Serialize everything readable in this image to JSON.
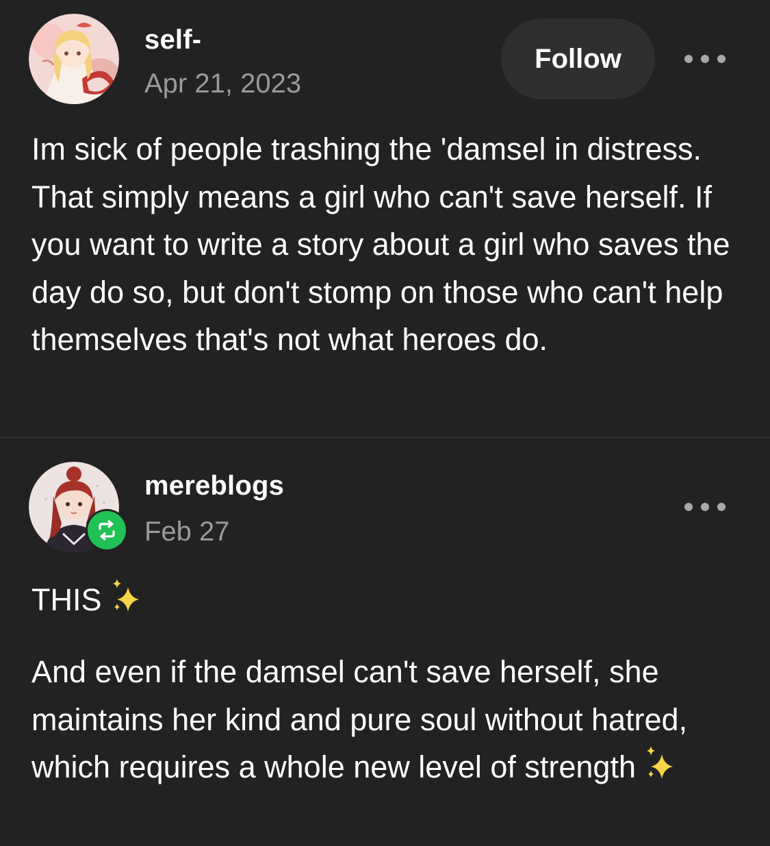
{
  "colors": {
    "background": "#222222",
    "text": "#ffffff",
    "muted": "#9a9a9a",
    "button_bg": "#2f2f2f",
    "reblog_green": "#21c255"
  },
  "posts": [
    {
      "username": "self-",
      "date": "Apr 21, 2023",
      "follow_label": "Follow",
      "avatar_icon": "anime-girl-avatar",
      "more_icon": "more-dots-icon",
      "body": "Im sick of people trashing the 'damsel in distress. That simply means a girl who can't save herself. If you want to write a story about a girl who saves the day do so, but don't stomp on those who can't help themselves that's not what heroes do."
    },
    {
      "username": "mereblogs",
      "date": "Feb 27",
      "avatar_icon": "red-haired-girl-avatar",
      "badge_icon": "reblog-icon",
      "more_icon": "more-dots-icon",
      "paragraph_1": "THIS",
      "paragraph_2": "And even if the damsel can't save herself, she maintains her kind and pure soul without hatred, which requires a whole new level of strength",
      "emoji_icon": "sparkles-icon"
    }
  ]
}
